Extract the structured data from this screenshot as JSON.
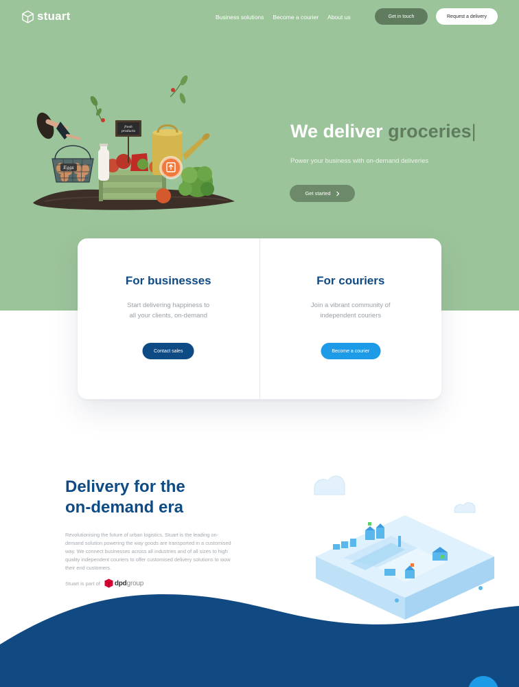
{
  "brand": {
    "name": "stuart",
    "logo_icon": "cube-logo-icon"
  },
  "nav": {
    "links": [
      "Business solutions",
      "Become a courier",
      "About us"
    ],
    "get_in_touch": "Get in touch",
    "request_delivery": "Request a delivery"
  },
  "hero": {
    "title_prefix": "We deliver ",
    "title_accent": "groceries",
    "cursor": "|",
    "subtitle": "Power your business with on-demand deliveries",
    "cta": "Get started",
    "cta_icon": "chevron-right-icon",
    "basket_label": "Eggs",
    "sign_label_1": "fresh",
    "sign_label_2": "products"
  },
  "cards": {
    "business": {
      "title": "For businesses",
      "line1": "Start delivering happiness to",
      "line2": "all your clients, on-demand",
      "button": "Contact sales"
    },
    "courier": {
      "title": "For couriers",
      "line1": "Join a vibrant community of",
      "line2": "independent couriers",
      "button": "Become a courier"
    }
  },
  "about": {
    "title_line1": "Delivery for the",
    "title_line2": "on-demand era",
    "body": "Revolutionising the future of urban logistics, Stuart is the leading on-demand solution powering the way goods are transported in a customised way. We connect businesses  across all industries and of all sizes to high quality independent couriers to offer customised delivery solutions to wow their end customers.",
    "part_of": "Stuart is part of",
    "partner_bold": "dpd",
    "partner_light": "group"
  },
  "colors": {
    "hero_bg": "#9cc49a",
    "accent_green": "#5f7d5e",
    "navy": "#0e4a84",
    "blue": "#1e9be7",
    "wave": "#114a82"
  }
}
